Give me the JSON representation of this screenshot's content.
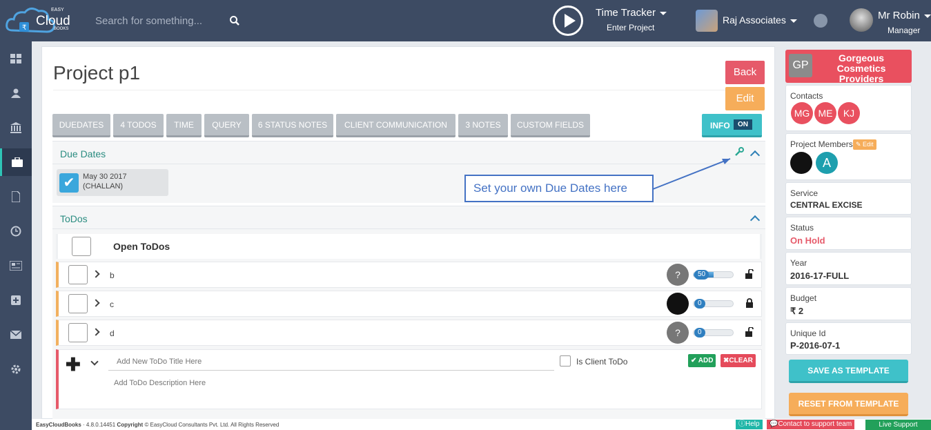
{
  "header": {
    "logo_small": "EASY",
    "logo_main": "Cloud",
    "logo_sub": "BOOKS",
    "search_placeholder": "Search for something...",
    "time_tracker_title": "Time Tracker",
    "time_tracker_sub": "Enter Project",
    "company": "Raj Associates",
    "user_name": "Mr Robin",
    "user_role": "Manager"
  },
  "sidebar": {
    "icons": [
      "dashboard-icon",
      "user-icon",
      "bank-icon",
      "briefcase-icon",
      "document-icon",
      "clock-icon",
      "newspaper-icon",
      "plus-square-icon",
      "envelope-icon",
      "gear-icon"
    ],
    "active_index": 3
  },
  "main": {
    "title": "Project p1",
    "back_label": "Back",
    "edit_label": "Edit",
    "tabs": [
      "DUEDATES",
      "4 TODOS",
      "TIME",
      "QUERY",
      "6 STATUS NOTES",
      "CLIENT COMMUNICATION",
      "3 NOTES",
      "CUSTOM FIELDS"
    ],
    "info_label": "INFO",
    "info_toggle": "ON"
  },
  "due_dates": {
    "heading": "Due Dates",
    "items": [
      {
        "date": "May 30 2017",
        "kind": "(CHALLAN)",
        "checked": true
      }
    ]
  },
  "callout": {
    "text": "Set your own Due Dates here"
  },
  "todos": {
    "heading": "ToDos",
    "open_label": "Open ToDos",
    "items": [
      {
        "name": "b",
        "assignee": "?",
        "progress": 50,
        "locked": false
      },
      {
        "name": "c",
        "assignee": "avatar",
        "progress": 0,
        "locked": true
      },
      {
        "name": "d",
        "assignee": "?",
        "progress": 0,
        "locked": false
      }
    ],
    "new_title_placeholder": "Add New ToDo Title Here",
    "new_desc_placeholder": "Add ToDo Description Here",
    "client_todo_label": "Is Client ToDo",
    "add_label": "ADD",
    "clear_label": "CLEAR"
  },
  "right_panel": {
    "client_initials": "GP",
    "client_name": "Gorgeous Cosmetics Providers",
    "contacts_label": "Contacts",
    "contacts": [
      "MG",
      "ME",
      "KJ"
    ],
    "members_label": "Project Members",
    "members_edit": "Edit",
    "members": [
      "photo",
      "A"
    ],
    "service_label": "Service",
    "service_value": "CENTRAL EXCISE",
    "status_label": "Status",
    "status_value": "On Hold",
    "year_label": "Year",
    "year_value": "2016-17-FULL",
    "budget_label": "Budget",
    "budget_value": "₹ 2",
    "uid_label": "Unique Id",
    "uid_value": "P-2016-07-1",
    "save_template": "SAVE AS TEMPLATE",
    "reset_template": "RESET FROM TEMPLATE"
  },
  "footer": {
    "app": "EasyCloudBooks",
    "version": "· 4.8.0.14451",
    "copyright_label": "Copyright",
    "copyright_text": "© EasyCloud Consultants Pvt. Ltd. All Rights Reserved",
    "help": "Help",
    "contact": "Contact to support team",
    "live": "Live Support"
  },
  "colors": {
    "topbar": "#3d4b63",
    "accent": "#2a8c80",
    "danger": "#e65a6a",
    "warning": "#f6ad5a",
    "info": "#3fc1c9",
    "status_on_hold": "#e65a6a",
    "callout": "#4472c4"
  }
}
